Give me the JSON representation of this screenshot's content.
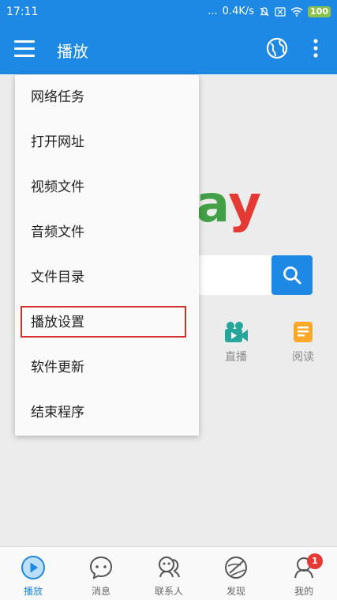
{
  "status_bar": {
    "time": "17:11",
    "dots": "...",
    "speed": "0.4K/s",
    "battery": "100"
  },
  "app_bar": {
    "title": "播放"
  },
  "menu": {
    "items": [
      "网络任务",
      "打开网址",
      "视频文件",
      "音频文件",
      "文件目录",
      "播放设置",
      "软件更新",
      "结束程序"
    ],
    "highlighted_item": "播放设置"
  },
  "background": {
    "logo_letters": [
      "a",
      "y"
    ],
    "quick_links": [
      {
        "label": "直播",
        "icon": "video-camera-icon",
        "color": "#26a69a"
      },
      {
        "label": "阅读",
        "icon": "document-icon",
        "color": "#ffa726"
      }
    ]
  },
  "bottom_nav": {
    "tabs": [
      {
        "label": "播放",
        "icon": "play-icon"
      },
      {
        "label": "消息",
        "icon": "chat-icon"
      },
      {
        "label": "联系人",
        "icon": "contacts-icon"
      },
      {
        "label": "发现",
        "icon": "discover-icon"
      },
      {
        "label": "我的",
        "icon": "profile-icon"
      }
    ],
    "active_tab": "播放",
    "badge_count": "1"
  },
  "colors": {
    "primary": "#1e88e5",
    "highlight_border": "#d32f2f",
    "badge": "#e53935"
  }
}
